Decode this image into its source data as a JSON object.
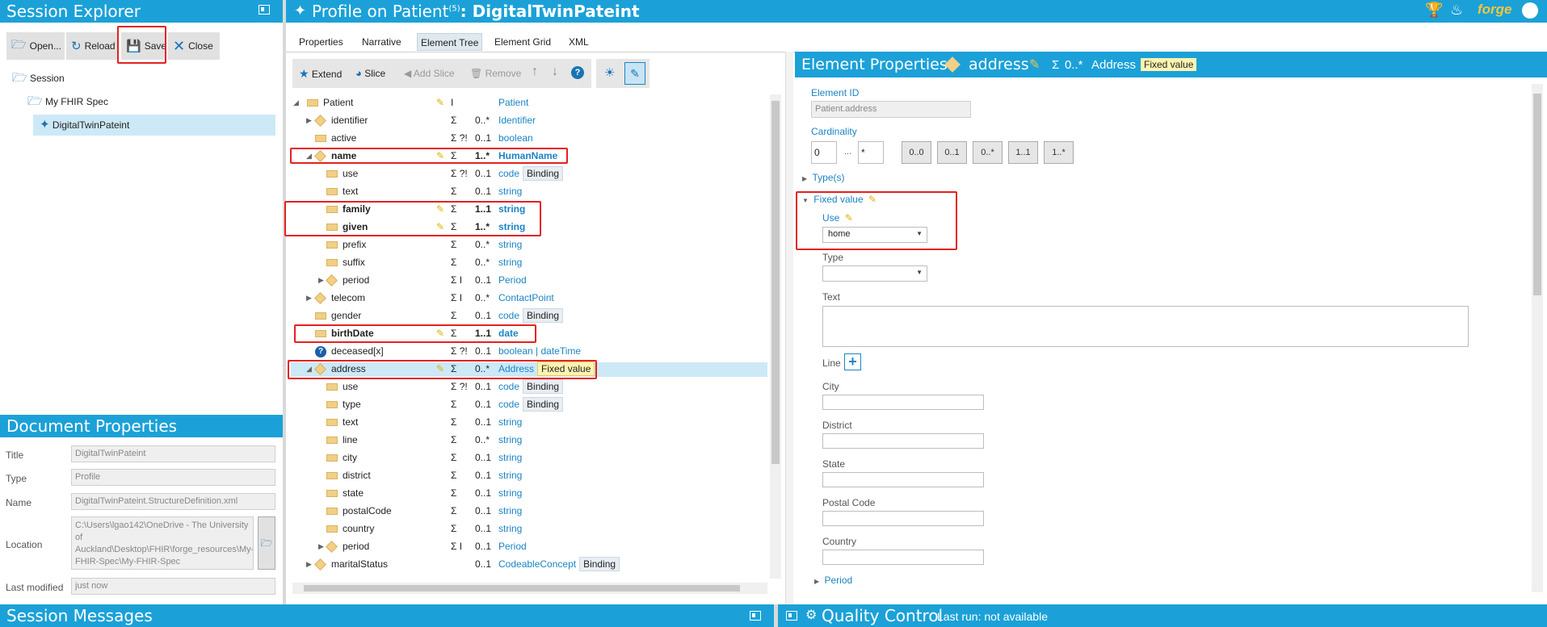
{
  "session_explorer": {
    "title": "Session Explorer",
    "toolbar": {
      "open": "Open...",
      "reload": "Reload",
      "save": "Save",
      "close": "Close"
    },
    "tree": {
      "session": "Session",
      "spec": "My FHIR Spec",
      "profile": "DigitalTwinPateint"
    }
  },
  "document_properties": {
    "title": "Document Properties",
    "fields": [
      {
        "label": "Title",
        "value": "DigitalTwinPateint"
      },
      {
        "label": "Type",
        "value": "Profile"
      },
      {
        "label": "Name",
        "value": "DigitalTwinPateint.StructureDefinition.xml"
      },
      {
        "label": "Location",
        "value": "C:\\Users\\lgao142\\OneDrive - The University of Auckland\\Desktop\\FHIR\\forge_resources\\My-FHIR-Spec\\My-FHIR-Spec"
      },
      {
        "label": "Last modified",
        "value": "just now"
      }
    ]
  },
  "session_messages": {
    "title": "Session Messages"
  },
  "profile": {
    "title_prefix": "Profile on Patient",
    "superscript": "(5)",
    "title_suffix": ": DigitalTwinPateint",
    "tabs": [
      "Properties",
      "Narrative",
      "Element Tree",
      "Element Grid",
      "XML"
    ],
    "active_tab": "Element Tree",
    "toolbar": {
      "extend": "Extend",
      "slice": "Slice",
      "add_slice": "Add Slice",
      "remove": "Remove"
    },
    "brand": "forge"
  },
  "element_tree": [
    {
      "name": "Patient",
      "flags": "I",
      "card": "",
      "type": "Patient"
    },
    {
      "name": "identifier",
      "flags": "Σ",
      "card": "0..*",
      "type": "Identifier"
    },
    {
      "name": "active",
      "flags": "Σ ?!",
      "card": "0..1",
      "type": "boolean"
    },
    {
      "name": "name",
      "flags": "Σ",
      "card": "1..*",
      "type": "HumanName"
    },
    {
      "name": "use",
      "flags": "Σ ?!",
      "card": "0..1",
      "type": "code",
      "badge": "Binding"
    },
    {
      "name": "text",
      "flags": "Σ",
      "card": "0..1",
      "type": "string"
    },
    {
      "name": "family",
      "flags": "Σ",
      "card": "1..1",
      "type": "string"
    },
    {
      "name": "given",
      "flags": "Σ",
      "card": "1..*",
      "type": "string"
    },
    {
      "name": "prefix",
      "flags": "Σ",
      "card": "0..*",
      "type": "string"
    },
    {
      "name": "suffix",
      "flags": "Σ",
      "card": "0..*",
      "type": "string"
    },
    {
      "name": "period",
      "flags": "Σ I",
      "card": "0..1",
      "type": "Period"
    },
    {
      "name": "telecom",
      "flags": "Σ I",
      "card": "0..*",
      "type": "ContactPoint"
    },
    {
      "name": "gender",
      "flags": "Σ",
      "card": "0..1",
      "type": "code",
      "badge": "Binding"
    },
    {
      "name": "birthDate",
      "flags": "Σ",
      "card": "1..1",
      "type": "date"
    },
    {
      "name": "deceased[x]",
      "flags": "Σ ?!",
      "card": "0..1",
      "type": "boolean | dateTime"
    },
    {
      "name": "address",
      "flags": "Σ",
      "card": "0..*",
      "type": "Address",
      "fixed": "Fixed value"
    },
    {
      "name": "use",
      "flags": "Σ ?!",
      "card": "0..1",
      "type": "code",
      "badge": "Binding"
    },
    {
      "name": "type",
      "flags": "Σ",
      "card": "0..1",
      "type": "code",
      "badge": "Binding"
    },
    {
      "name": "text",
      "flags": "Σ",
      "card": "0..1",
      "type": "string"
    },
    {
      "name": "line",
      "flags": "Σ",
      "card": "0..*",
      "type": "string"
    },
    {
      "name": "city",
      "flags": "Σ",
      "card": "0..1",
      "type": "string"
    },
    {
      "name": "district",
      "flags": "Σ",
      "card": "0..1",
      "type": "string"
    },
    {
      "name": "state",
      "flags": "Σ",
      "card": "0..1",
      "type": "string"
    },
    {
      "name": "postalCode",
      "flags": "Σ",
      "card": "0..1",
      "type": "string"
    },
    {
      "name": "country",
      "flags": "Σ",
      "card": "0..1",
      "type": "string"
    },
    {
      "name": "period",
      "flags": "Σ I",
      "card": "0..1",
      "type": "Period"
    },
    {
      "name": "maritalStatus",
      "flags": "",
      "card": "0..1",
      "type": "CodeableConcept",
      "badge": "Binding"
    }
  ],
  "element_properties": {
    "title": "Element Properties:",
    "element": "address",
    "sigma": "Σ",
    "card": "0..*",
    "type": "Address",
    "fixed": "Fixed value",
    "element_id_label": "Element ID",
    "element_id": "Patient.address",
    "cardinality_label": "Cardinality",
    "min": "0",
    "dots": "...",
    "max": "*",
    "card_buttons": [
      "0..0",
      "0..1",
      "0..*",
      "1..1",
      "1..*"
    ],
    "types_label": "Type(s)",
    "fixed_value_label": "Fixed value",
    "use_label": "Use",
    "use_value": "home",
    "type_label": "Type",
    "text_label": "Text",
    "line_label": "Line",
    "city_label": "City",
    "district_label": "District",
    "state_label": "State",
    "postal_label": "Postal Code",
    "country_label": "Country",
    "period_label": "Period"
  },
  "quality_control": {
    "title": "Quality Control",
    "last_run": "Last run: not available"
  }
}
